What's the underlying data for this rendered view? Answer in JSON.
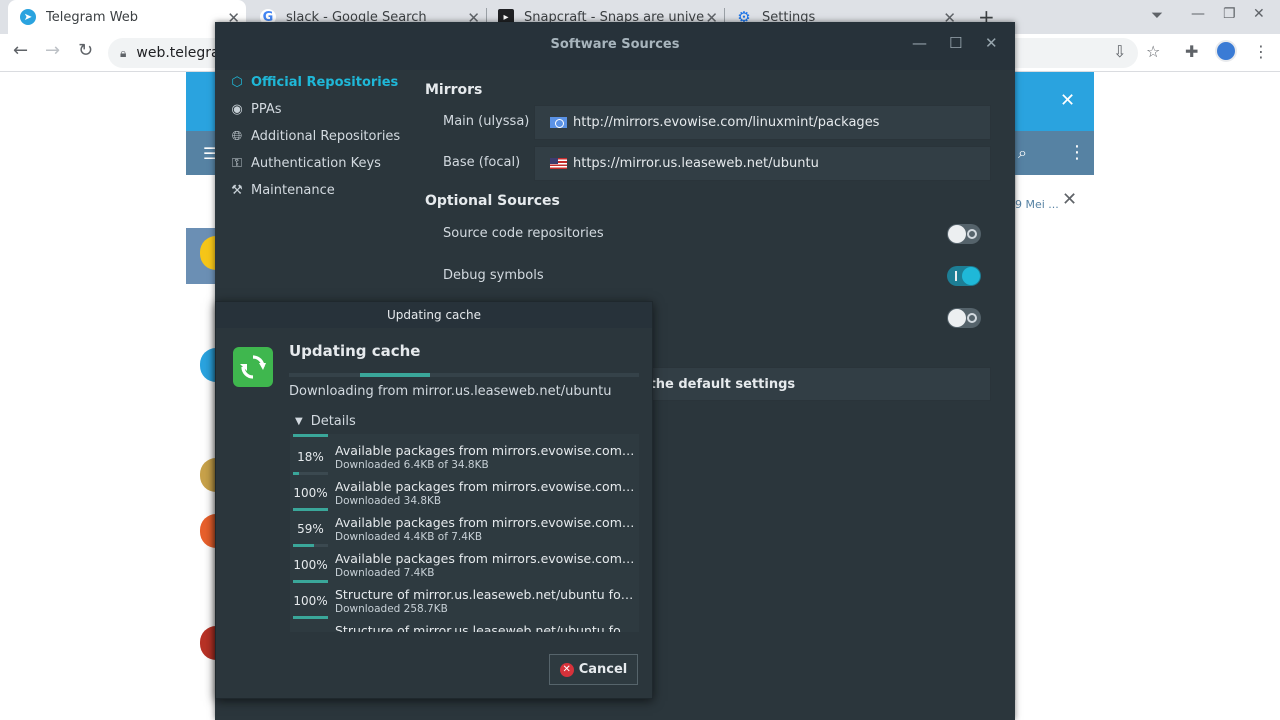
{
  "browser": {
    "tabs": [
      {
        "title": "Telegram Web",
        "icon": "telegram-icon"
      },
      {
        "title": "slack - Google Search",
        "icon": "google-icon"
      },
      {
        "title": "Snapcraft - Snaps are universal",
        "icon": "snapcraft-icon"
      },
      {
        "title": "Settings",
        "icon": "gear-icon"
      }
    ],
    "url": "web.telegra"
  },
  "telegram": {
    "date_preview": "9 Mei ..."
  },
  "software_sources": {
    "title": "Software Sources",
    "sidebar": [
      {
        "label": "Official Repositories",
        "icon": "package-icon",
        "active": true
      },
      {
        "label": "PPAs",
        "icon": "ppa-icon",
        "active": false
      },
      {
        "label": "Additional Repositories",
        "icon": "globe-icon",
        "active": false
      },
      {
        "label": "Authentication Keys",
        "icon": "key-icon",
        "active": false
      },
      {
        "label": "Maintenance",
        "icon": "tools-icon",
        "active": false
      }
    ],
    "mirrors_heading": "Mirrors",
    "mirrors": [
      {
        "label": "Main (ulyssa)",
        "url": "http://mirrors.evowise.com/linuxmint/packages",
        "flag": "un-flag"
      },
      {
        "label": "Base (focal)",
        "url": "https://mirror.us.leaseweb.net/ubuntu",
        "flag": "us-flag"
      }
    ],
    "optional_heading": "Optional Sources",
    "optional": [
      {
        "label": "Source code repositories",
        "enabled": false
      },
      {
        "label": "Debug symbols",
        "enabled": true
      },
      {
        "label": "",
        "enabled": false
      }
    ],
    "restore_label": "ore the default settings"
  },
  "updating_cache": {
    "title": "Updating cache",
    "heading": "Updating cache",
    "status": "Downloading from mirror.us.leaseweb.net/ubuntu",
    "details_label": "Details",
    "cancel_label": "Cancel",
    "items": [
      {
        "percent": "18%",
        "progress": 0.18,
        "name": "Available packages from mirrors.evowise.com/linuxmint/packages",
        "sub": "Downloaded 6.4KB of 34.8KB"
      },
      {
        "percent": "100%",
        "progress": 1.0,
        "name": "Available packages from mirrors.evowise.com/linuxmint/packages",
        "sub": "Downloaded 34.8KB"
      },
      {
        "percent": "59%",
        "progress": 0.59,
        "name": "Available packages from mirrors.evowise.com/linuxmint/packages",
        "sub": "Downloaded 4.4KB of 7.4KB"
      },
      {
        "percent": "100%",
        "progress": 1.0,
        "name": "Available packages from mirrors.evowise.com/linuxmint/packages",
        "sub": "Downloaded 7.4KB"
      },
      {
        "percent": "100%",
        "progress": 1.0,
        "name": "Structure of mirror.us.leaseweb.net/ubuntu focal",
        "sub": "Downloaded 258.7KB"
      },
      {
        "percent": "",
        "progress": 0,
        "name": "Structure of mirror.us.leaseweb.net/ubuntu focal",
        "sub": ""
      }
    ]
  }
}
